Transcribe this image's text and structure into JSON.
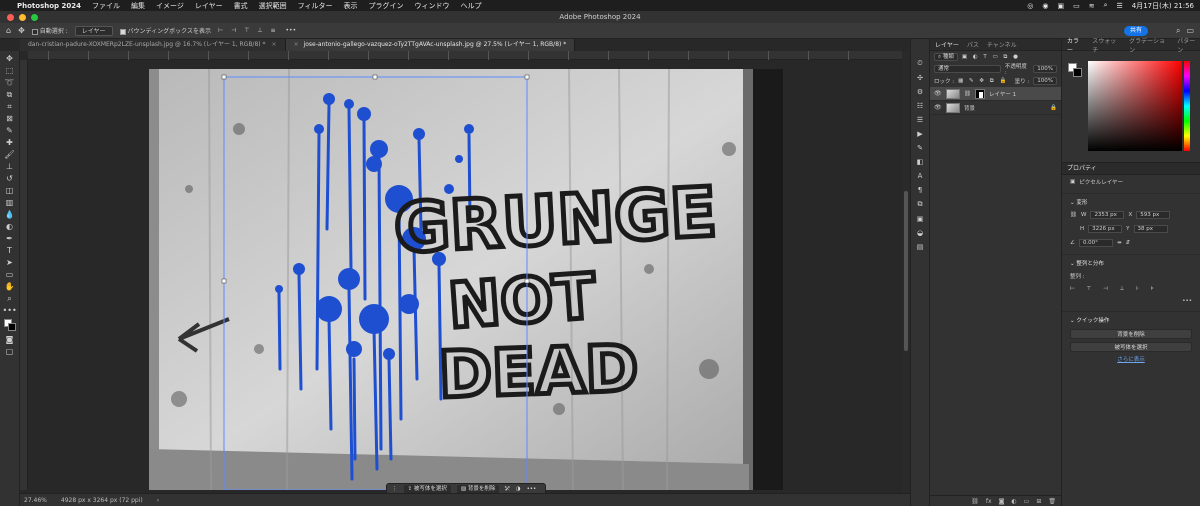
{
  "menubar": {
    "app": "Photoshop 2024",
    "items": [
      "ファイル",
      "編集",
      "イメージ",
      "レイヤー",
      "書式",
      "選択範囲",
      "フィルター",
      "表示",
      "プラグイン",
      "ウィンドウ",
      "ヘルプ"
    ],
    "clock": "4月17日(木) 21:56"
  },
  "window": {
    "title": "Adobe Photoshop 2024"
  },
  "options": {
    "auto_select": "自動選択 :",
    "layer_select": "レイヤー",
    "bbox": "バウンディングボックスを表示",
    "share": "共有"
  },
  "tabs": [
    {
      "label": "dan-cristian-padure-XOXMERp2LZE-unsplash.jpg @ 16.7% (レイヤー 1, RGB/8) *"
    },
    {
      "label": "jose-antonio-gallego-vazquez-oTy2TTgAVAc-unsplash.jpg @ 27.5% (レイヤー 1, RGB/8) *"
    }
  ],
  "context_bar": {
    "select_subject": "被写体を選択",
    "remove_bg": "背景を削除"
  },
  "status": {
    "zoom": "27.46%",
    "dims": "4928 px x 3264 px (72 ppi)"
  },
  "layers_panel": {
    "tabs": [
      "レイヤー",
      "パス",
      "チャンネル"
    ],
    "kind": "種類",
    "blend": "通常",
    "opacity_label": "不透明度 :",
    "opacity": "100%",
    "lock_label": "ロック :",
    "fill_label": "塗り :",
    "fill": "100%",
    "layers": [
      {
        "name": "レイヤー 1"
      },
      {
        "name": "背景"
      }
    ]
  },
  "color_panel": {
    "tabs": [
      "カラー",
      "スウォッチ",
      "グラデーション",
      "パターン"
    ]
  },
  "properties": {
    "title": "プロパティ",
    "type": "ピクセルレイヤー",
    "transform": "変形",
    "w_label": "W",
    "w": "2353 px",
    "x_label": "X",
    "x": "593 px",
    "h_label": "H",
    "h": "3226 px",
    "y_label": "Y",
    "y": "38 px",
    "angle": "0.00°",
    "align": "整列と分布",
    "align_label": "整列 :",
    "quick": "クイック操作",
    "btn_remove_bg": "背景を削除",
    "btn_select_subject": "被写体を選択",
    "more": "さらに表示"
  },
  "image": {
    "line1": "GRUNGE",
    "line2": "NOT",
    "line3": "DEAD"
  }
}
